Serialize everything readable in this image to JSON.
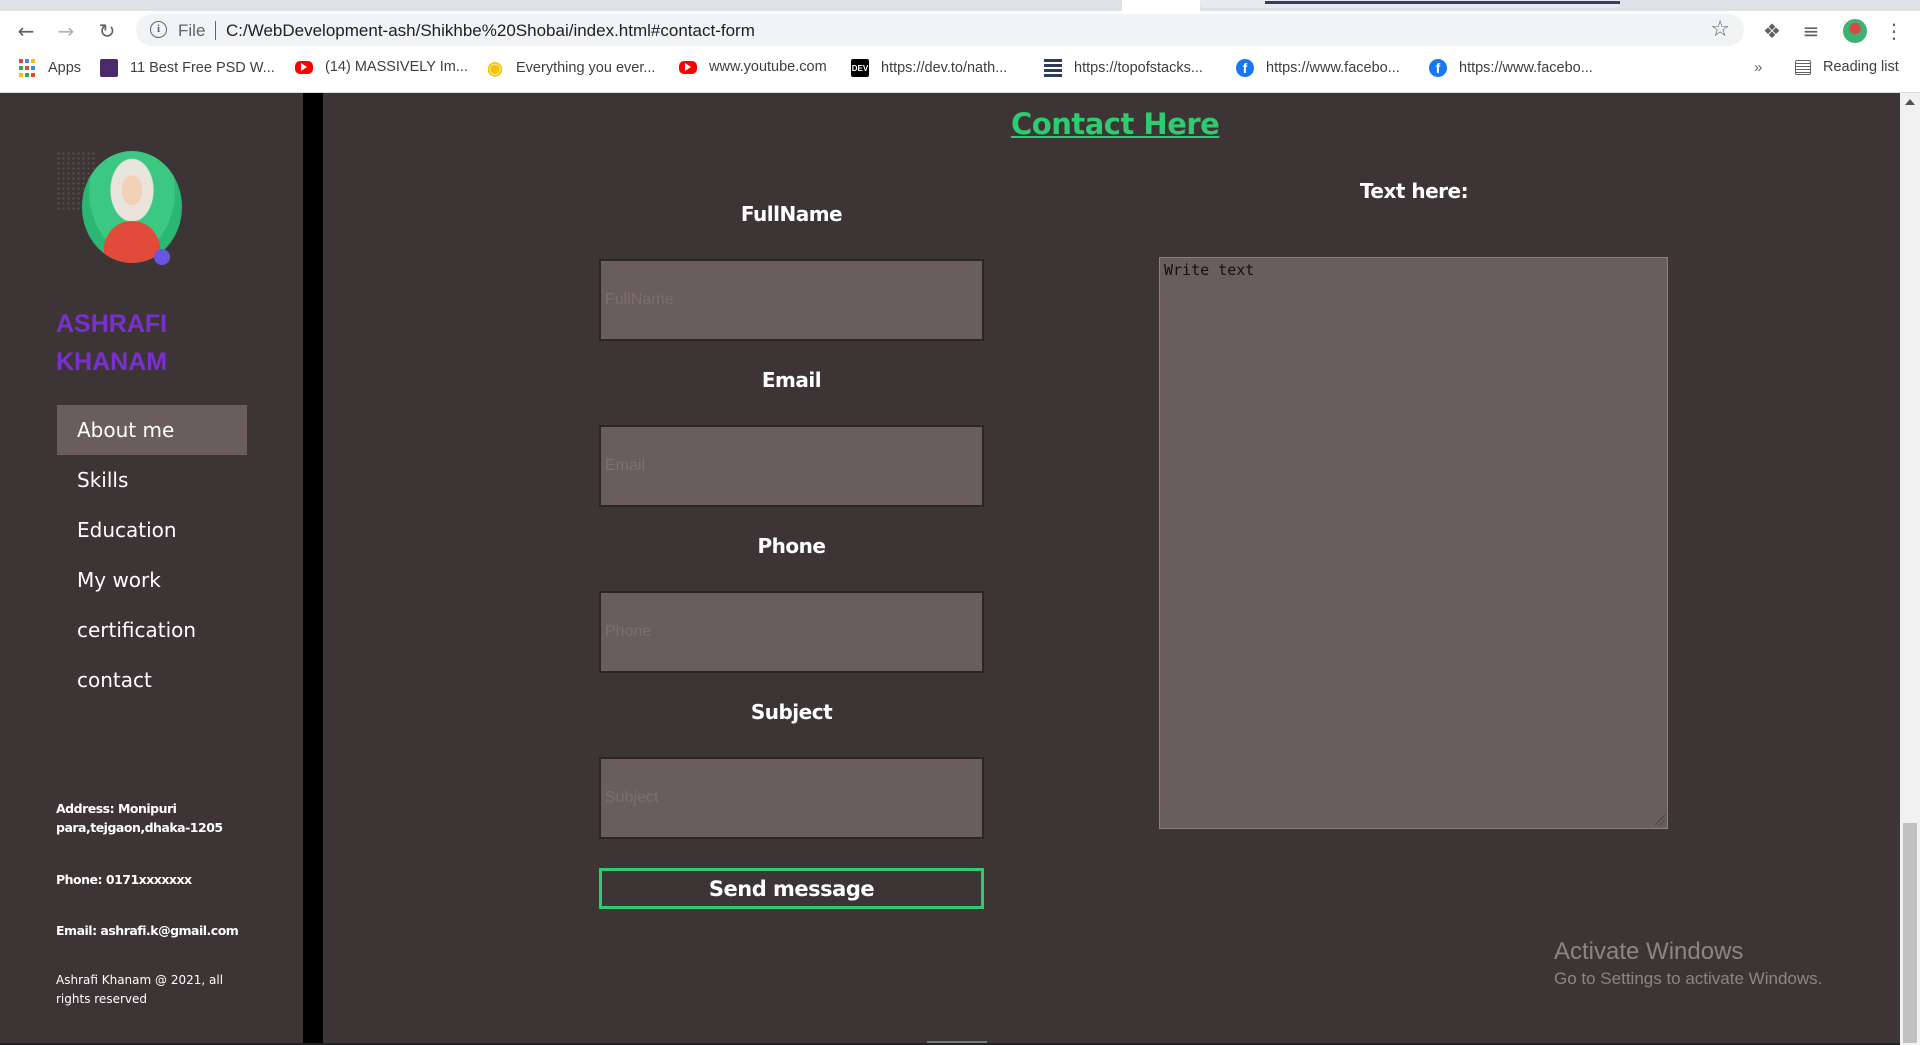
{
  "browser": {
    "file_label": "File",
    "url": "C:/WebDevelopment-ash/Shikhbe%20Shobai/index.html#contact-form",
    "bookmarks": [
      {
        "label": "Apps",
        "icon": "apps-grid-icon"
      },
      {
        "label": "11 Best Free PSD W...",
        "icon": "colorlib-icon"
      },
      {
        "label": "(14) MASSIVELY Im...",
        "icon": "youtube-icon"
      },
      {
        "label": "Everything you ever...",
        "icon": "lightbulb-icon"
      },
      {
        "label": "www.youtube.com",
        "icon": "youtube-icon"
      },
      {
        "label": "https://dev.to/nath...",
        "icon": "dev-icon"
      },
      {
        "label": "https://topofstacks...",
        "icon": "stack-icon"
      },
      {
        "label": "https://www.facebo...",
        "icon": "facebook-icon"
      },
      {
        "label": "https://www.facebo...",
        "icon": "facebook-icon"
      }
    ],
    "more_label": "»",
    "reading_list_label": "Reading list"
  },
  "sidebar": {
    "name_line1": "ASHRAFI",
    "name_line2": "KHANAM",
    "nav": [
      {
        "label": "About me",
        "active": true
      },
      {
        "label": "Skills",
        "active": false
      },
      {
        "label": "Education",
        "active": false
      },
      {
        "label": "My work",
        "active": false
      },
      {
        "label": "certification",
        "active": false
      },
      {
        "label": "contact",
        "active": false
      }
    ],
    "address_line1": "Address: Monipuri",
    "address_line2": "para,tejgaon,dhaka-1205",
    "phone": "Phone: 0171xxxxxxx",
    "email": "Email: ashrafi.k@gmail.com",
    "copyright_line1": "Ashrafi Khanam @ 2021, all",
    "copyright_line2": "rights reserved"
  },
  "contact": {
    "title": "Contact Here",
    "fields": [
      {
        "label": "FullName",
        "placeholder": "FullName"
      },
      {
        "label": "Email",
        "placeholder": "Email"
      },
      {
        "label": "Phone",
        "placeholder": "Phone"
      },
      {
        "label": "Subject",
        "placeholder": "Subject"
      }
    ],
    "message_label": "Text here:",
    "message_placeholder": "Write text",
    "send_label": "Send message"
  },
  "os_watermark": {
    "line1": "Activate Windows",
    "line2": "Go to Settings to activate Windows."
  },
  "colors": {
    "page_bg": "#3d3535",
    "accent_green": "#2ecc71",
    "name_purple": "#7b2fd0",
    "input_bg": "#6a5d5d"
  }
}
